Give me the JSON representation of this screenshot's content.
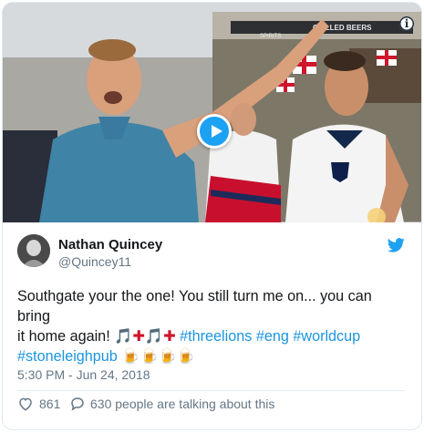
{
  "tweet": {
    "display_name": "Nathan Quincey",
    "handle": "@Quincey11",
    "text_line1": "Southgate your the one! You still turn me on... you can bring",
    "text_line2_prefix": "it home again! ",
    "emoji_note": "🎵",
    "emoji_flag": "✚",
    "hashtags": [
      "#threelions",
      "#eng",
      "#worldcup",
      "#stoneleighpub"
    ],
    "emoji_beer": "🍺",
    "timestamp": "5:30 PM - Jun 24, 2018",
    "likes": "861",
    "talking": "630 people are talking about this"
  },
  "video": {
    "background_sign": "CHILLED BEERS",
    "background_sign2": "SPIRITS",
    "info_glyph": "i"
  },
  "icons": {
    "info": "info-icon",
    "play": "play-icon",
    "twitter": "twitter-bird-icon",
    "like": "heart-icon",
    "reply": "speech-bubble-icon"
  },
  "colors": {
    "accent": "#1da1f2",
    "hashtag": "#1b95e0",
    "muted": "#657786",
    "text": "#14171a"
  }
}
